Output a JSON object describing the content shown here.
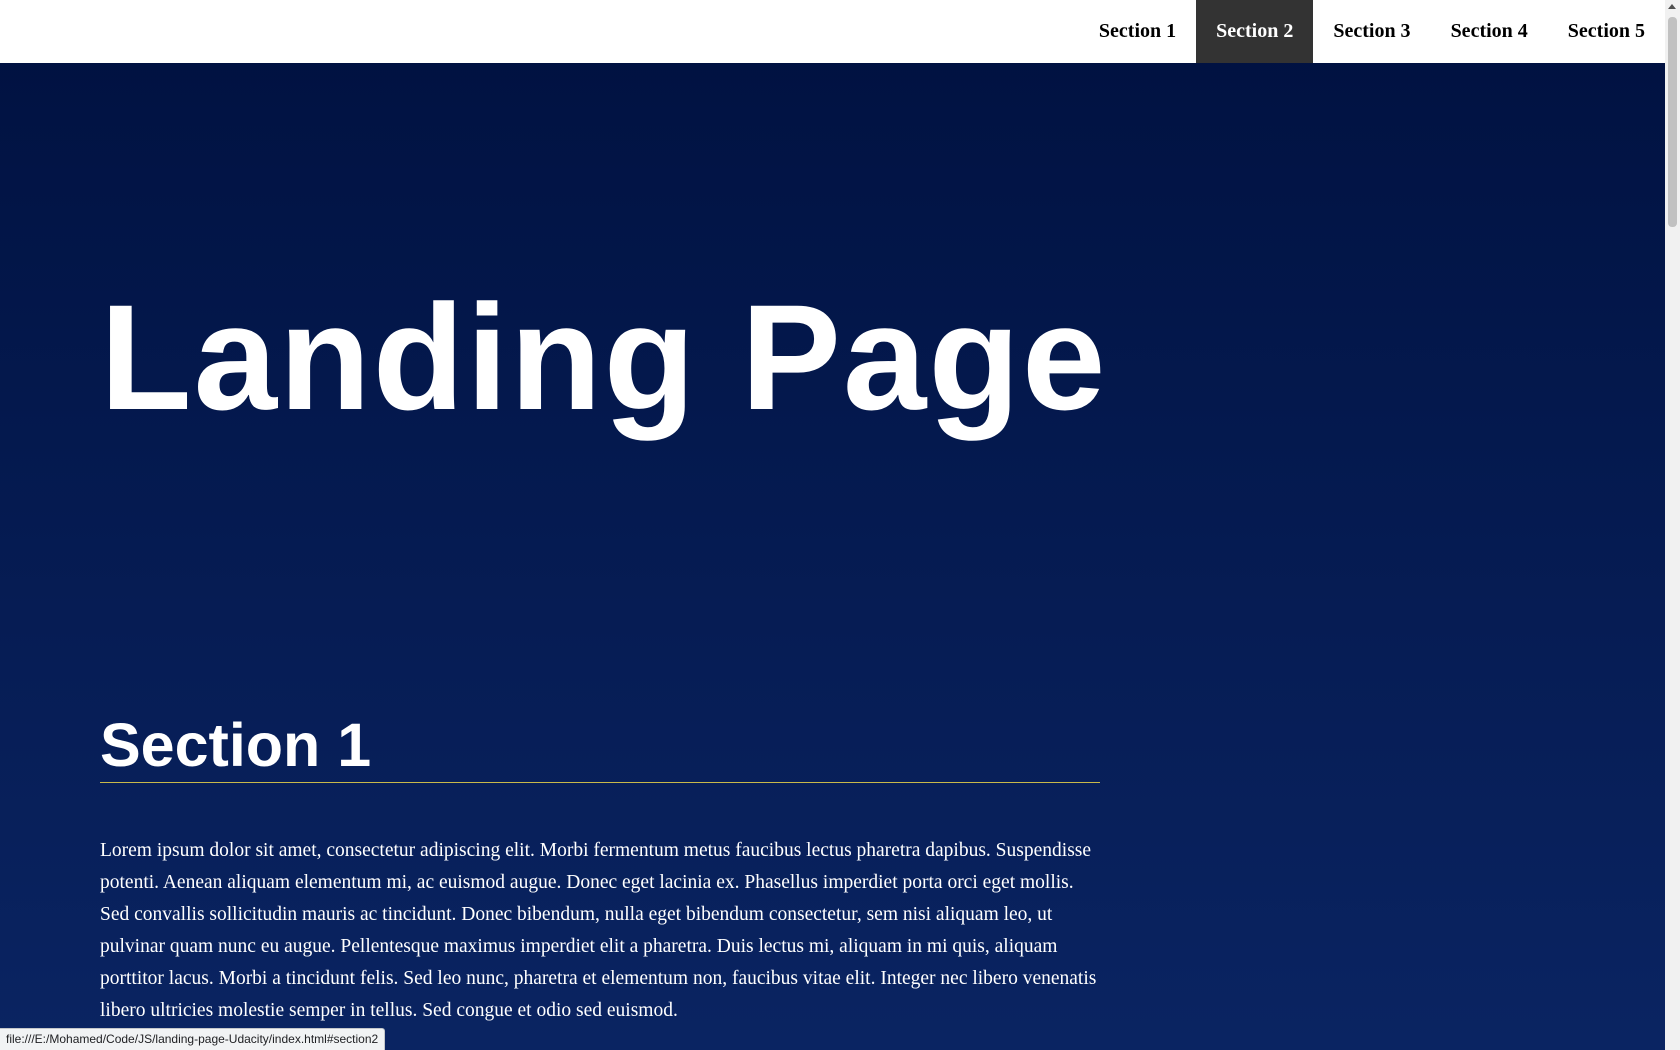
{
  "navbar": {
    "items": [
      {
        "label": "Section 1",
        "active": false
      },
      {
        "label": "Section 2",
        "active": true
      },
      {
        "label": "Section 3",
        "active": false
      },
      {
        "label": "Section 4",
        "active": false
      },
      {
        "label": "Section 5",
        "active": false
      }
    ],
    "active_color": "#333333"
  },
  "hero": {
    "title": "Landing Page"
  },
  "sections": [
    {
      "title": "Section 1",
      "text": "Lorem ipsum dolor sit amet, consectetur adipiscing elit. Morbi fermentum metus faucibus lectus pharetra dapibus. Suspendisse potenti. Aenean aliquam elementum mi, ac euismod augue. Donec eget lacinia ex. Phasellus imperdiet porta orci eget mollis. Sed convallis sollicitudin mauris ac tincidunt. Donec bibendum, nulla eget bibendum consectetur, sem nisi aliquam leo, ut pulvinar quam nunc eu augue. Pellentesque maximus imperdiet elit a pharetra. Duis lectus mi, aliquam in mi quis, aliquam porttitor lacus. Morbi a tincidunt felis. Sed leo nunc, pharetra et elementum non, faucibus vitae elit. Integer nec libero venenatis libero ultricies molestie semper in tellus. Sed congue et odio sed euismod."
    }
  ],
  "status_bar": {
    "url": "file:///E:/Mohamed/Code/JS/landing-page-Udacity/index.html#section2"
  },
  "colors": {
    "background_top": "#001140",
    "background_bottom": "#0a2462",
    "section_underline": "#c9b94a"
  }
}
